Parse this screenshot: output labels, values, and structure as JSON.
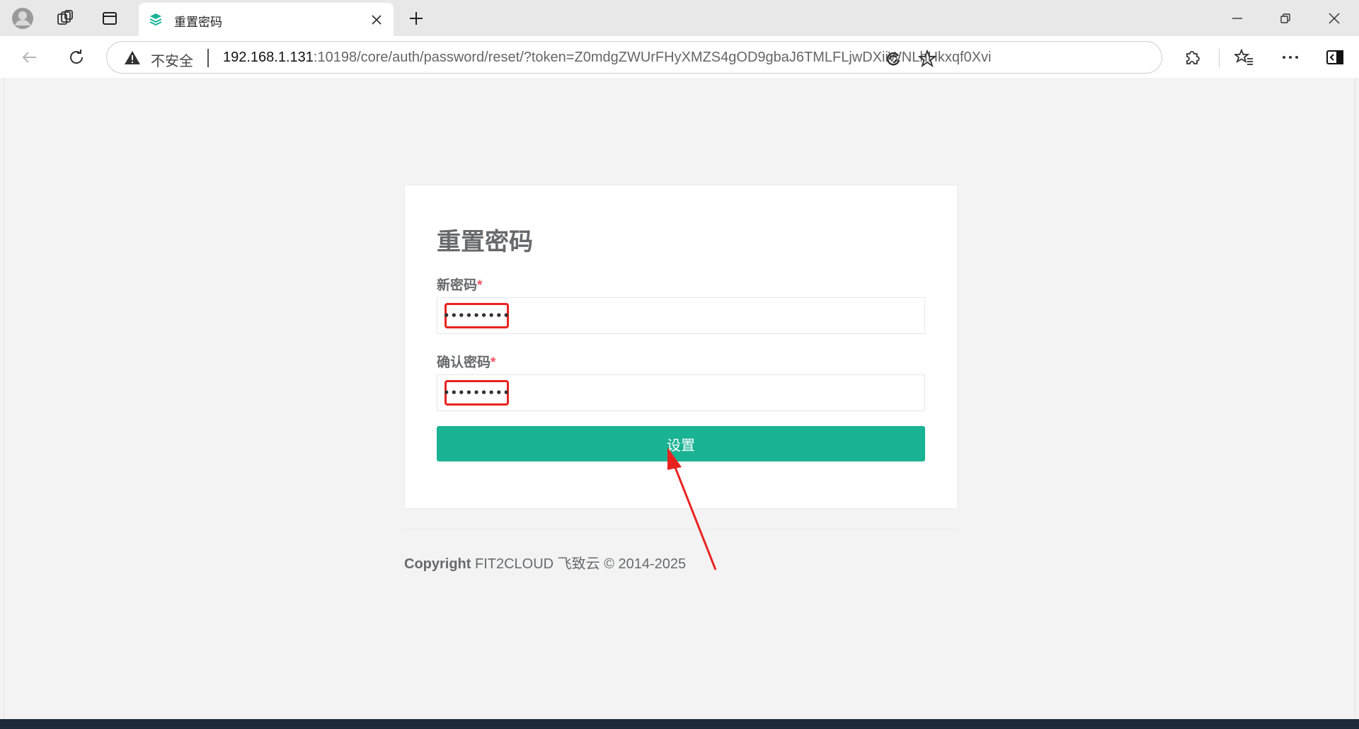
{
  "browser": {
    "tab_title": "重置密码",
    "security_label": "不安全",
    "url_host": "192.168.1.131",
    "url_rest": ":10198/core/auth/password/reset/?token=Z0mdgZWUrFHyXMZS4gOD9gbaJ6TMLFLjwDXiiWNLhHkxqf0Xvi"
  },
  "page": {
    "title": "重置密码",
    "new_password_label": "新密码",
    "confirm_password_label": "确认密码",
    "required_mark": "*",
    "new_password_value": "•••••••••",
    "confirm_password_value": "•••••••••",
    "submit_label": "设置",
    "copyright_bold": "Copyright",
    "copyright_rest": " FIT2CLOUD 飞致云 © 2014-2025"
  },
  "colors": {
    "accent": "#1ab394",
    "annotation": "#e8231f",
    "required": "#ed5565"
  }
}
